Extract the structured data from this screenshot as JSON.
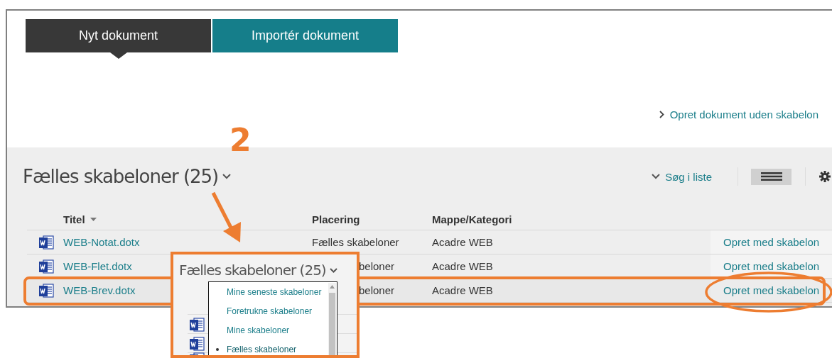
{
  "tabs": [
    {
      "label": "Nyt dokument",
      "selected": true
    },
    {
      "label": "Importér dokument",
      "selected": false
    }
  ],
  "create_without_template_link": "Opret dokument uden skabelon",
  "step_number": "2",
  "list": {
    "title": "Fælles skabeloner (25)",
    "search_label": "Søg i liste",
    "columns": [
      "Titel",
      "Placering",
      "Mappe/Kategori"
    ],
    "rows": [
      {
        "title": "WEB-Notat.dotx",
        "location": "Fælles skabeloner",
        "folder": "Acadre WEB",
        "action": "Opret med skabelon",
        "highlighted": false,
        "partly_covered": false
      },
      {
        "title": "WEB-Flet.dotx",
        "location": "beloner",
        "folder": "Acadre WEB",
        "action": "Opret med skabelon",
        "highlighted": false,
        "partly_covered": true
      },
      {
        "title": "WEB-Brev.dotx",
        "location": "beloner",
        "folder": "Acadre WEB",
        "action": "Opret med skabelon",
        "highlighted": true,
        "partly_covered": true
      }
    ]
  },
  "callout": {
    "title": "Fælles skabeloner (25)",
    "menu": [
      {
        "label": "Mine seneste skabeloner",
        "selected": false
      },
      {
        "label": "Foretrukne skabeloner",
        "selected": false
      },
      {
        "label": "Mine skabeloner",
        "selected": false
      },
      {
        "label": "Fælles skabeloner",
        "selected": true
      }
    ]
  }
}
